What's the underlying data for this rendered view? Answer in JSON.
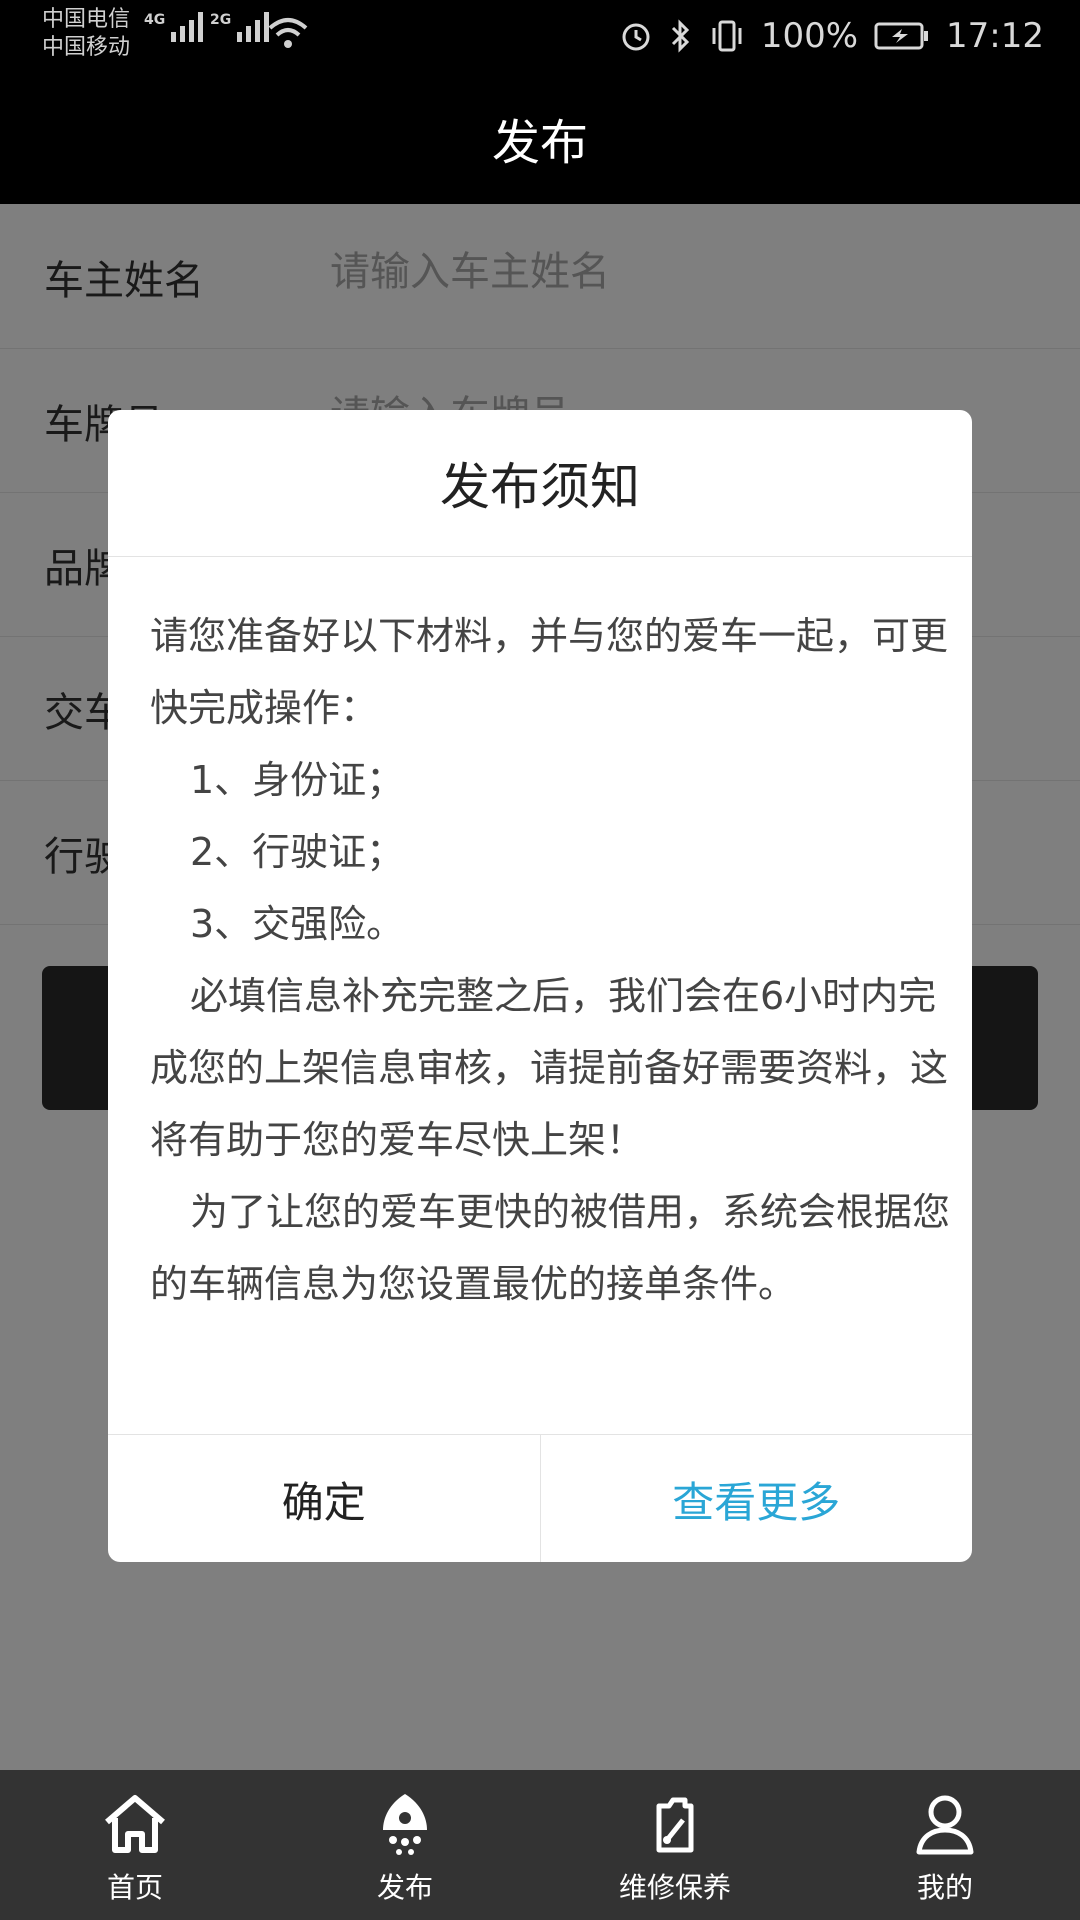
{
  "status_bar": {
    "carrier_1": "中国电信",
    "carrier_2": "中国移动",
    "net_1": "4G",
    "net_2": "2G",
    "battery": "100%",
    "time": "17:12"
  },
  "header": {
    "title": "发布"
  },
  "form": {
    "fields": [
      {
        "label": "车主姓名",
        "placeholder": "请输入车主姓名"
      },
      {
        "label": "车牌号",
        "placeholder": "请输入车牌号"
      },
      {
        "label": "品牌型号",
        "placeholder": ""
      },
      {
        "label": "交车地点",
        "placeholder": ""
      },
      {
        "label": "行驶证",
        "placeholder": ""
      }
    ],
    "submit_label": ""
  },
  "dialog": {
    "title": "发布须知",
    "body": {
      "intro": "请您准备好以下材料，并与您的爱车一起，可更快完成操作：",
      "item_1": "1、身份证；",
      "item_2": "2、行驶证；",
      "item_3": "3、交强险。",
      "para_1": "必填信息补充完整之后，我们会在6小时内完成您的上架信息审核，请提前备好需要资料，这将有助于您的爱车尽快上架！",
      "para_2": "为了让您的爱车更快的被借用，系统会根据您的车辆信息为您设置最优的接单条件。"
    },
    "confirm_label": "确定",
    "more_label": "查看更多"
  },
  "tabbar": {
    "items": [
      {
        "label": "首页",
        "icon": "home-icon"
      },
      {
        "label": "发布",
        "icon": "rocket-icon"
      },
      {
        "label": "维修保养",
        "icon": "wrench-icon"
      },
      {
        "label": "我的",
        "icon": "user-icon"
      }
    ]
  },
  "colors": {
    "accent": "#2aa6d6",
    "header_bg": "#000000",
    "tabbar_bg": "#333333"
  }
}
